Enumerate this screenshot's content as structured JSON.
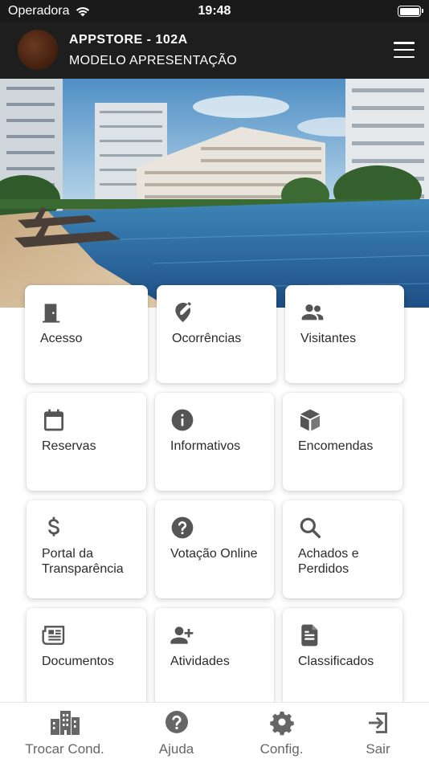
{
  "status_bar": {
    "carrier": "Operadora",
    "time": "19:48"
  },
  "header": {
    "title": "APPSTORE - 102A",
    "subtitle": "MODELO APRESENTAÇÃO",
    "menu_icon": "hamburger-menu-icon"
  },
  "hero": {
    "description_icon": "condo-pool-photo"
  },
  "menu": {
    "items": [
      {
        "label": "Acesso",
        "icon": "door-icon"
      },
      {
        "label": "Ocorrências",
        "icon": "edit-pin-icon"
      },
      {
        "label": "Visitantes",
        "icon": "people-icon"
      },
      {
        "label": "Reservas",
        "icon": "calendar-icon"
      },
      {
        "label": "Informativos",
        "icon": "info-icon"
      },
      {
        "label": "Encomendas",
        "icon": "package-icon"
      },
      {
        "label": "Portal da Transparência",
        "icon": "dollar-icon"
      },
      {
        "label": "Votação Online",
        "icon": "question-icon"
      },
      {
        "label": "Achados e Perdidos",
        "icon": "search-icon"
      },
      {
        "label": "Documentos",
        "icon": "newspaper-icon"
      },
      {
        "label": "Atividades",
        "icon": "add-person-icon"
      },
      {
        "label": "Classificados",
        "icon": "document-icon"
      }
    ]
  },
  "tabbar": {
    "items": [
      {
        "label": "Trocar Cond.",
        "icon": "buildings-icon"
      },
      {
        "label": "Ajuda",
        "icon": "help-icon"
      },
      {
        "label": "Config.",
        "icon": "gear-icon"
      },
      {
        "label": "Sair",
        "icon": "exit-icon"
      }
    ]
  },
  "colors": {
    "header_bg": "#1e1e1e",
    "icon": "#555555",
    "tab_icon": "#666666"
  }
}
